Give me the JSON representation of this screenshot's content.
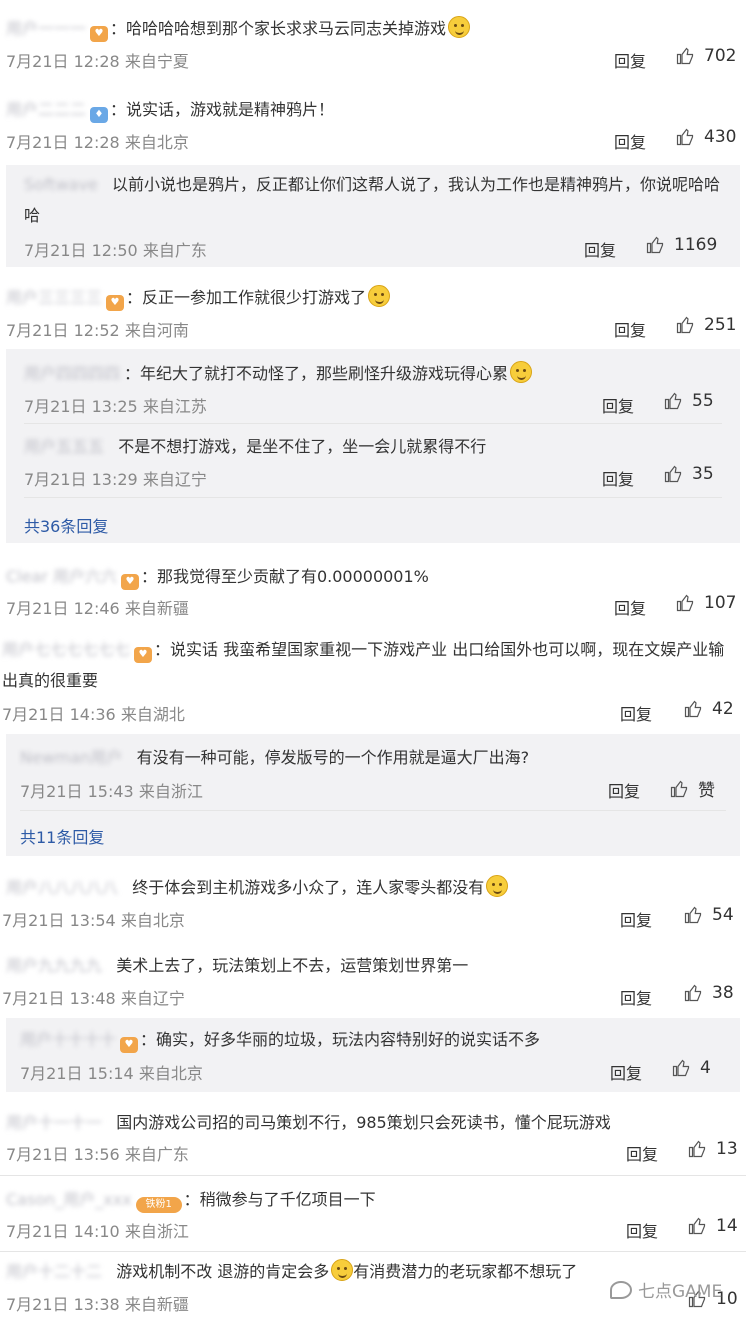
{
  "reply_label": "回复",
  "c1": {
    "user": "用户一一一",
    "text": "哈哈哈哈想到那个家长求求马云同志关掉游戏",
    "time": "7月21日 12:28 来自宁夏",
    "likes": "702"
  },
  "c2": {
    "user": "用户二二二",
    "text": "说实话，游戏就是精神鸦片！",
    "time": "7月21日 12:28 来自北京",
    "likes": "430"
  },
  "c2r1": {
    "user": "Softwave",
    "text": "以前小说也是鸦片，反正都让你们这帮人说了，我认为工作也是精神鸦片，你说呢哈哈哈",
    "time": "7月21日 12:50 来自广东",
    "likes": "1169"
  },
  "c3": {
    "user": "用户三三三三",
    "text": "反正一参加工作就很少打游戏了",
    "time": "7月21日 12:52 来自河南",
    "likes": "251"
  },
  "c3r1": {
    "user": "用户四四四四",
    "text": "年纪大了就打不动怪了，那些刷怪升级游戏玩得心累",
    "time": "7月21日 13:25 来自江苏",
    "likes": "55"
  },
  "c3r2": {
    "user": "用户五五五",
    "text": "不是不想打游戏，是坐不住了，坐一会儿就累得不行",
    "time": "7月21日 13:29 来自辽宁",
    "likes": "35"
  },
  "c3_more": "共36条回复",
  "c4": {
    "user": "Clear 用户六六",
    "text": "那我觉得至少贡献了有0.00000001%",
    "time": "7月21日 12:46 来自新疆",
    "likes": "107"
  },
  "c5": {
    "user": "用户七七七七七七",
    "text": "说实话 我蛮希望国家重视一下游戏产业 出口给国外也可以啊，现在文娱产业输出真的很重要",
    "time": "7月21日 14:36 来自湖北",
    "likes": "42"
  },
  "c5r1": {
    "user": "Newman用户",
    "text": "有没有一种可能，停发版号的一个作用就是逼大厂出海?",
    "time": "7月21日 15:43 来自浙江",
    "likes": "赞"
  },
  "c5_more": "共11条回复",
  "c6": {
    "user": "用户八八八八八",
    "text": "终于体会到主机游戏多小众了，连人家零头都没有",
    "time": "7月21日 13:54 来自北京",
    "likes": "54"
  },
  "c7": {
    "user": "用户九九九九",
    "text": "美术上去了，玩法策划上不去，运营策划世界第一",
    "time": "7月21日 13:48 来自辽宁",
    "likes": "38"
  },
  "c7r1": {
    "user": "用户十十十十",
    "text": "确实，好多华丽的垃圾，玩法内容特别好的说实话不多",
    "time": "7月21日 15:14 来自北京",
    "likes": "4"
  },
  "c8": {
    "user": "用户十一十一",
    "text": "国内游戏公司招的司马策划不行，985策划只会死读书，懂个屁玩游戏",
    "time": "7月21日 13:56 来自广东",
    "likes": "13"
  },
  "c9": {
    "user": "Cason_用户_xxx",
    "badge": "铁粉1",
    "text": "稍微参与了千亿项目一下",
    "time": "7月21日 14:10 来自浙江",
    "likes": "14"
  },
  "c10": {
    "user": "用户十二十二",
    "text_a": "游戏机制不改 退游的肯定会多",
    "text_b": "有消费潜力的老玩家都不想玩了",
    "time": "7月21日 13:38 来自新疆",
    "likes": "10"
  },
  "watermark": "七点GAME",
  "colors": {
    "subreply_bg": "#f2f2f4",
    "link": "#2d5aa6",
    "meta": "#888888",
    "badge": "#f2a54a"
  }
}
